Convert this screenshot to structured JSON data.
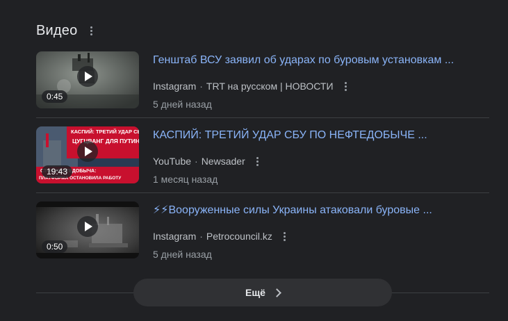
{
  "section": {
    "title": "Видео"
  },
  "videos": [
    {
      "title": "Генштаб ВСУ заявил об ударах по буровым установкам ...",
      "source": "Instagram",
      "channel": "TRT на русском | НОВОСТИ",
      "age": "5 дней назад",
      "duration": "0:45"
    },
    {
      "title": "КАСПИЙ: ТРЕТИЙ УДАР СБУ ПО НЕФТЕДОБЫЧЕ ...",
      "source": "YouTube",
      "channel": "Newsader",
      "age": "1 месяц назад",
      "duration": "19:43",
      "thumb_text": {
        "line1": "КАСПИЙ: ТРЕТИЙ УДАР СБУ!",
        "line2": "ЦУГЦВАНГ ДЛЯ ПУТИНА",
        "line3": "СТОП НЕФТЕДОБЫЧА:",
        "line4": "ПЛАТФОРМА ОСТАНОВИЛА РАБОТУ"
      }
    },
    {
      "title": "⚡⚡Вооруженные силы Украины атаковали буровые ...",
      "source": "Instagram",
      "channel": "Petrocouncil.kz",
      "age": "5 дней назад",
      "duration": "0:50"
    }
  ],
  "more_button": {
    "label": "Ещё"
  },
  "colors": {
    "background": "#202124",
    "link": "#8ab4f8",
    "text": "#bdc1c6",
    "button": "#303134",
    "thumb_red": "#c8102e"
  }
}
